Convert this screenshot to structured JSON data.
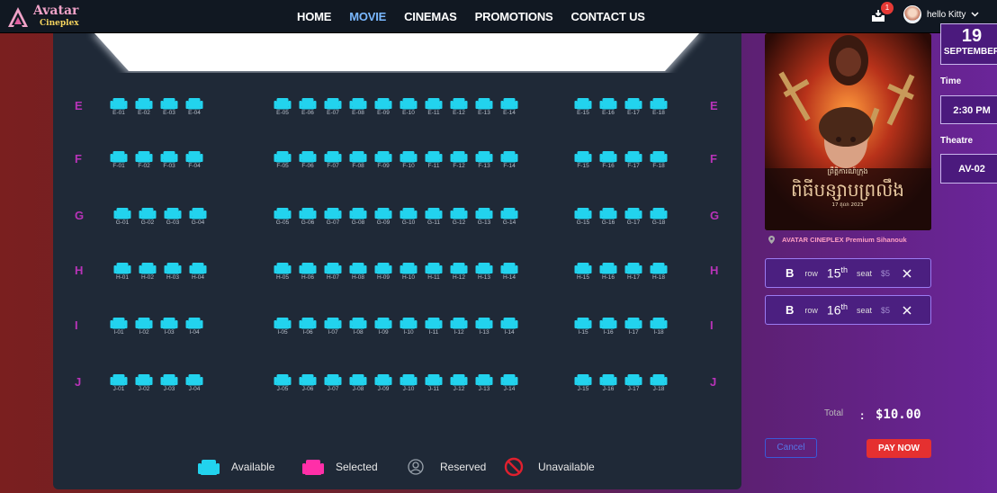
{
  "brand": {
    "name_line1": "Avatar",
    "name_line2": "Cineplex"
  },
  "nav": {
    "items": [
      "HOME",
      "MOVIE",
      "CINEMAS",
      "PROMOTIONS",
      "CONTACT US"
    ],
    "active": "MOVIE"
  },
  "notifications": {
    "count": "1"
  },
  "user": {
    "name": "hello Kitty"
  },
  "rows": [
    "E",
    "F",
    "G",
    "H",
    "I",
    "J"
  ],
  "seats_per_row": 18,
  "legend": {
    "available": "Available",
    "selected": "Selected",
    "reserved": "Reserved",
    "unavailable": "Unavailable"
  },
  "colors": {
    "available": "#22d3ee",
    "selected": "#ff2fa8",
    "row_label": "#b833b8",
    "pay": "#e53030"
  },
  "movie": {
    "poster_title": "ពិធីបន្សាបព្រលឹង",
    "poster_date": "17 តុលា 2023",
    "poster_subtitle": "ព្រឹត្តិការណ៍ក្រុង"
  },
  "location": "AVATAR CINEPLEX Premium Sihanouk",
  "date": {
    "day": "19",
    "month": "SEPTEMBER"
  },
  "time": {
    "label": "Time",
    "value": "2:30 PM"
  },
  "theatre": {
    "label": "Theatre",
    "value": "AV-02"
  },
  "tickets": [
    {
      "row": "B",
      "row_label": "row",
      "seat": "15",
      "seat_suffix": "th",
      "seat_label": "seat",
      "price": "$5"
    },
    {
      "row": "B",
      "row_label": "row",
      "seat": "16",
      "seat_suffix": "th",
      "seat_label": "seat",
      "price": "$5"
    }
  ],
  "total": {
    "label": "Total",
    "colon": ":",
    "value": "$10.00"
  },
  "buttons": {
    "cancel": "Cancel",
    "pay": "PAY NOW"
  }
}
